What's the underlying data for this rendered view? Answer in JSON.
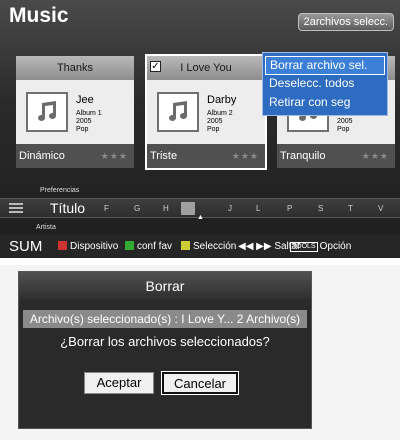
{
  "header": {
    "title": "Music",
    "selected_badge": "2archivos selecc."
  },
  "cards": [
    {
      "title": "Thanks",
      "artist": "Jee",
      "album": "Album 1",
      "year": "2005",
      "genre": "Pop",
      "mood": "Dinámico",
      "stars": "★★★"
    },
    {
      "title": "I Love You",
      "artist": "Darby",
      "album": "Album 2",
      "year": "2005",
      "genre": "Pop",
      "mood": "Triste",
      "stars": "★★★",
      "checked": "✓"
    },
    {
      "artist": "",
      "year": "2005",
      "genre": "Pop",
      "mood": "Tranquilo",
      "stars": "★★★"
    }
  ],
  "options_menu": {
    "items": [
      "Borrar archivo sel.",
      "Deselecc. todos",
      "Retirar con seg"
    ],
    "active_index": 0
  },
  "sort_bar": {
    "above_label": "Preferencias",
    "current": "Título",
    "below_label": "Artista",
    "index_letters": [
      "F",
      "G",
      "H",
      "J",
      "L",
      "P",
      "S",
      "T",
      "V"
    ],
    "cursor_symbol": "▲"
  },
  "guide_bar": {
    "sum": "SUM",
    "device": "Dispositivo",
    "favorites": "conf fav",
    "selection": "Selección",
    "skip_arrows": "◀◀ ▶▶",
    "skip": "Saltar",
    "tools_icon": "TOOLS",
    "option": "Opción"
  },
  "dialog": {
    "title": "Borrar",
    "info": "Archivo(s) seleccionado(s) : I Love Y... 2 Archivo(s)",
    "question": "¿Borrar los archivos seleccionados?",
    "accept_label": "Aceptar",
    "cancel_label": "Cancelar"
  },
  "colors": {
    "menu_blue": "#2d6cc0",
    "dialog_bg": "#2a2a2a"
  }
}
